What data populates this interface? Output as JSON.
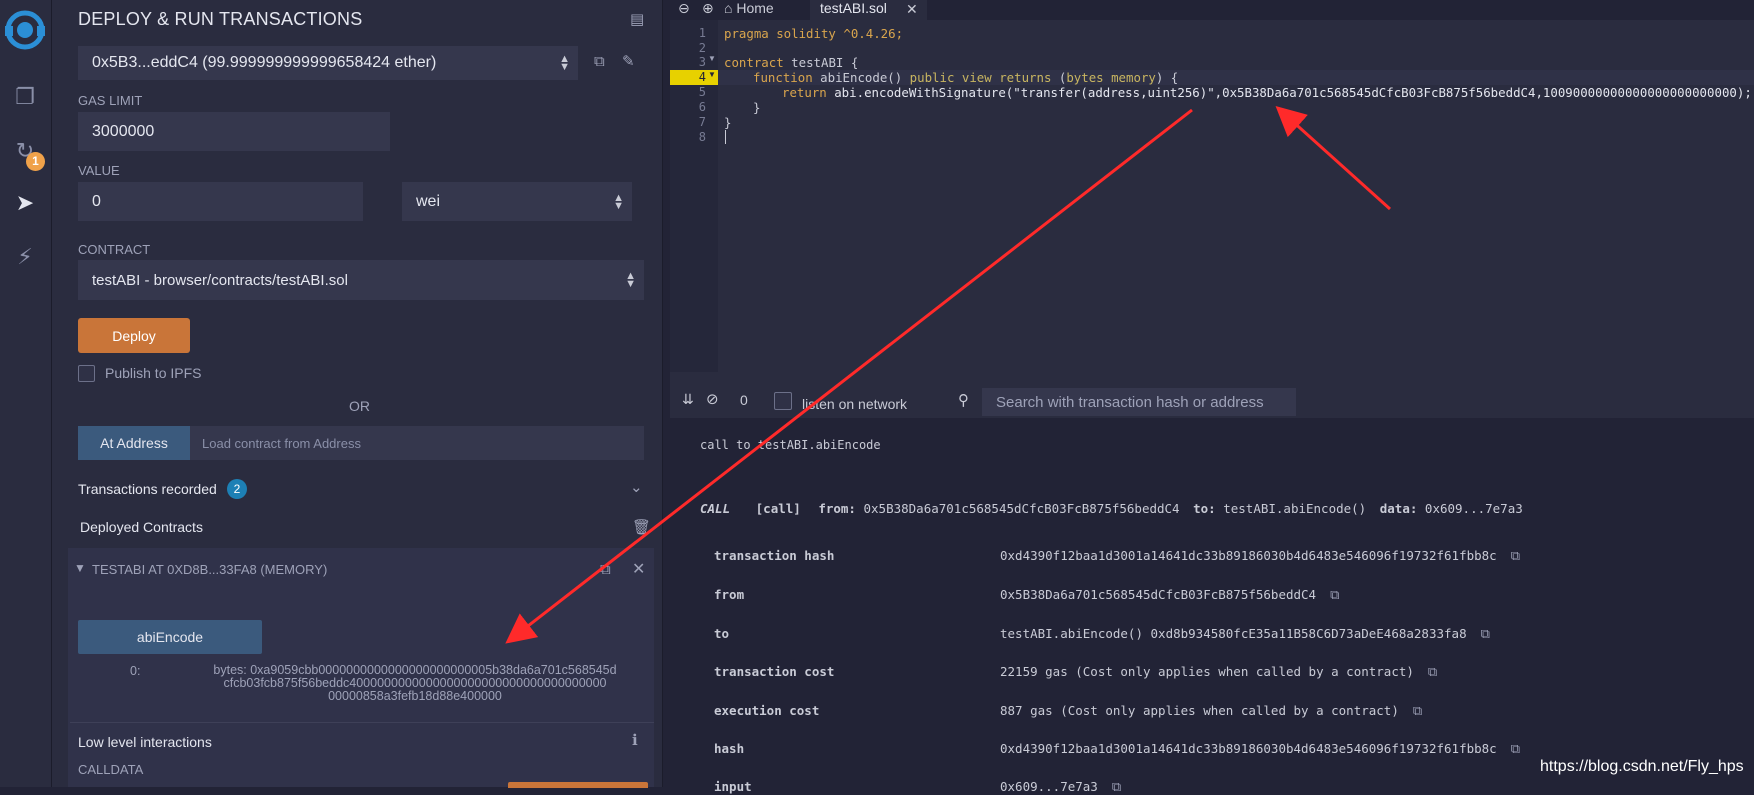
{
  "rail": {
    "icons": [
      "remix-logo-icon",
      "file-explorer-icon",
      "compiler-icon",
      "deploy-run-icon",
      "settings-plug-icon"
    ],
    "compiler_badge": "1"
  },
  "panel": {
    "title": "DEPLOY & RUN TRANSACTIONS",
    "account": "0x5B3...eddC4 (99.999999999999658424 ether)",
    "gas_limit_label": "GAS LIMIT",
    "gas_limit_value": "3000000",
    "value_label": "VALUE",
    "value_amount": "0",
    "value_unit": "wei",
    "contract_label": "CONTRACT",
    "contract_value": "testABI - browser/contracts/testABI.sol",
    "deploy_label": "Deploy",
    "publish_label": "Publish to IPFS",
    "or_label": "OR",
    "at_address_label": "At Address",
    "at_address_placeholder": "Load contract from Address",
    "transactions_recorded_label": "Transactions recorded",
    "transactions_recorded_count": "2",
    "deployed_contracts_label": "Deployed Contracts",
    "instance_title": "TESTABI AT 0XD8B...33FA8 (MEMORY)",
    "abi_button_label": "abiEncode",
    "result_index": "0:",
    "result_lines": [
      "bytes: 0xa9059cbb0000000000000000000000005b38da6a701c568545d",
      "cfcb03fcb875f56beddc4000000000000000000000000000000000000",
      "00000858a3fefb18d88e400000"
    ],
    "low_level_label": "Low level interactions",
    "calldata_label": "CALLDATA"
  },
  "editor": {
    "home_tab": "Home",
    "file_tab": "testABI.sol",
    "lines": [
      "1",
      "2",
      "3",
      "4",
      "5",
      "6",
      "7",
      "8"
    ],
    "code": {
      "l1_kw": "pragma solidity",
      "l1_rest": " ^0.4.26;",
      "l3_kw": "contract",
      "l3_rest": " testABI {",
      "l4_a": "function",
      "l4_b": " abiEncode() ",
      "l4_c": "public view returns",
      "l4_d": " (",
      "l4_e": "bytes memory",
      "l4_f": ") {",
      "l5_a": "return",
      "l5_b": " abi.encodeWithSignature(\"transfer(address,uint256)\",0x5B38Da6a701c568545dCfcB03FcB875f56beddC4,10090000000000000000000000);",
      "l6": "}",
      "l7": "}"
    }
  },
  "terminal": {
    "pending_count": "0",
    "listen_label": "listen on network",
    "search_placeholder": "Search with transaction hash or address",
    "call_text": "call to testABI.abiEncode",
    "call_row": {
      "tag": "CALL",
      "kind": "[call]",
      "from_label": "from:",
      "from_value": "0x5B38Da6a701c568545dCfcB03FcB875f56beddC4",
      "to_label": "to:",
      "to_value": "testABI.abiEncode()",
      "data_label": "data:",
      "data_value": "0x609...7e7a3"
    },
    "details": [
      {
        "key": "transaction hash",
        "value": "0xd4390f12baa1d3001a14641dc33b89186030b4d6483e546096f19732f61fbb8c"
      },
      {
        "key": "from",
        "value": "0x5B38Da6a701c568545dCfcB03FcB875f56beddC4"
      },
      {
        "key": "to",
        "value": "testABI.abiEncode() 0xd8b934580fcE35a11B58C6D73aDeE468a2833fa8"
      },
      {
        "key": "transaction cost",
        "value": "22159 gas (Cost only applies when called by a contract)"
      },
      {
        "key": "execution cost",
        "value": "887 gas (Cost only applies when called by a contract)"
      },
      {
        "key": "hash",
        "value": "0xd4390f12baa1d3001a14641dc33b89186030b4d6483e546096f19732f61fbb8c"
      },
      {
        "key": "input",
        "value": "0x609...7e7a3"
      }
    ]
  },
  "watermark": "https://blog.csdn.net/Fly_hps",
  "colors": {
    "arrow": "#ff2a2a",
    "deploy": "#c97539",
    "accent_blue": "#3b5a7d"
  }
}
